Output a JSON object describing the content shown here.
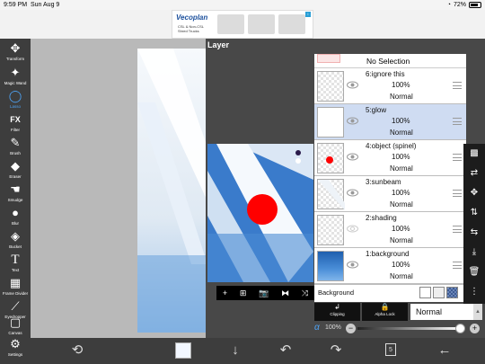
{
  "status_bar": {
    "time": "9:59 PM",
    "date": "Sun Aug 9",
    "battery": "72%"
  },
  "ad": {
    "brand": "Vecoplan",
    "tagline": "CSL & Non-CSL Shred Trucks"
  },
  "toolbar": {
    "tools": [
      {
        "label": "Transform",
        "icon": "move-icon"
      },
      {
        "label": "Magic Wand",
        "icon": "magic-wand-icon"
      },
      {
        "label": "Lasso",
        "icon": "lasso-icon",
        "active": true
      },
      {
        "label": "Filter",
        "icon": "fx-icon"
      },
      {
        "label": "Brush",
        "icon": "brush-icon"
      },
      {
        "label": "Eraser",
        "icon": "eraser-icon"
      },
      {
        "label": "Smudge",
        "icon": "smudge-icon"
      },
      {
        "label": "Blur",
        "icon": "drop-icon"
      },
      {
        "label": "Bucket",
        "icon": "bucket-icon"
      },
      {
        "label": "Text",
        "icon": "text-icon"
      },
      {
        "label": "Frame Divider",
        "icon": "frame-divider-icon"
      },
      {
        "label": "Eyedropper",
        "icon": "eyedropper-icon"
      },
      {
        "label": "Canvas",
        "icon": "canvas-icon"
      },
      {
        "label": "Settings",
        "icon": "gear-icon"
      }
    ]
  },
  "layer_panel": {
    "title": "Layer",
    "no_selection": "No Selection",
    "layers": [
      {
        "name": "6:ignore this",
        "opacity": "100%",
        "blend": "Normal",
        "visible": true,
        "selected": false
      },
      {
        "name": "5:glow",
        "opacity": "100%",
        "blend": "Normal",
        "visible": true,
        "selected": true
      },
      {
        "name": "4:object (spinel)",
        "opacity": "100%",
        "blend": "Normal",
        "visible": true,
        "selected": false
      },
      {
        "name": "3:sunbeam",
        "opacity": "100%",
        "blend": "Normal",
        "visible": true,
        "selected": false
      },
      {
        "name": "2:shading",
        "opacity": "100%",
        "blend": "Normal",
        "visible": false,
        "selected": false
      },
      {
        "name": "1:background",
        "opacity": "100%",
        "blend": "Normal",
        "visible": true,
        "selected": false
      }
    ],
    "background_label": "Background",
    "clipping_label": "Clipping",
    "alpha_lock_label": "Alpha Lock",
    "blend_mode": "Normal",
    "alpha_symbol": "α",
    "alpha_value": "100%",
    "alpha_fraction": 1.0,
    "preview_bar_icons": [
      "+",
      "⊞",
      "📷",
      "⧓",
      "⤨"
    ],
    "side_icons": [
      "checker-icon",
      "transfer-icon",
      "move-icon",
      "flip-vertical-icon",
      "flip-horizontal-icon",
      "merge-down-icon",
      "trash-icon",
      "more-icon"
    ]
  },
  "bottom_bar": {
    "page_count": "5"
  },
  "colors": {
    "accent": "#4ea3f5",
    "toolbar_bg": "#3d3d3d",
    "selected_layer": "#cfdcf2",
    "red_object": "#ff0000"
  }
}
